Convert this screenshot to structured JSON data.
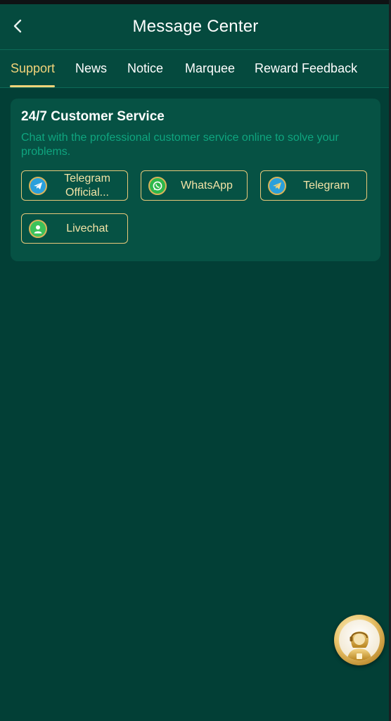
{
  "header": {
    "title": "Message Center"
  },
  "tabs": [
    {
      "label": "Support",
      "active": true
    },
    {
      "label": "News",
      "active": false
    },
    {
      "label": "Notice",
      "active": false
    },
    {
      "label": "Marquee",
      "active": false
    },
    {
      "label": "Reward Feedback",
      "active": false
    }
  ],
  "support_card": {
    "title": "24/7 Customer Service",
    "description": "Chat with the professional customer service online to solve your problems.",
    "buttons": [
      {
        "label_line1": "Telegram",
        "label_line2": "Official...",
        "icon": "telegram-icon"
      },
      {
        "label": "WhatsApp",
        "icon": "whatsapp-icon"
      },
      {
        "label": "Telegram",
        "icon": "telegram-icon"
      },
      {
        "label": "Livechat",
        "icon": "livechat-icon"
      }
    ]
  },
  "floating_button": {
    "icon": "customer-service-agent-icon"
  },
  "colors": {
    "background": "#023f36",
    "header": "#054a3e",
    "card": "#065244",
    "accent_gold": "#f2d37a",
    "description_text": "#0fa57f"
  }
}
